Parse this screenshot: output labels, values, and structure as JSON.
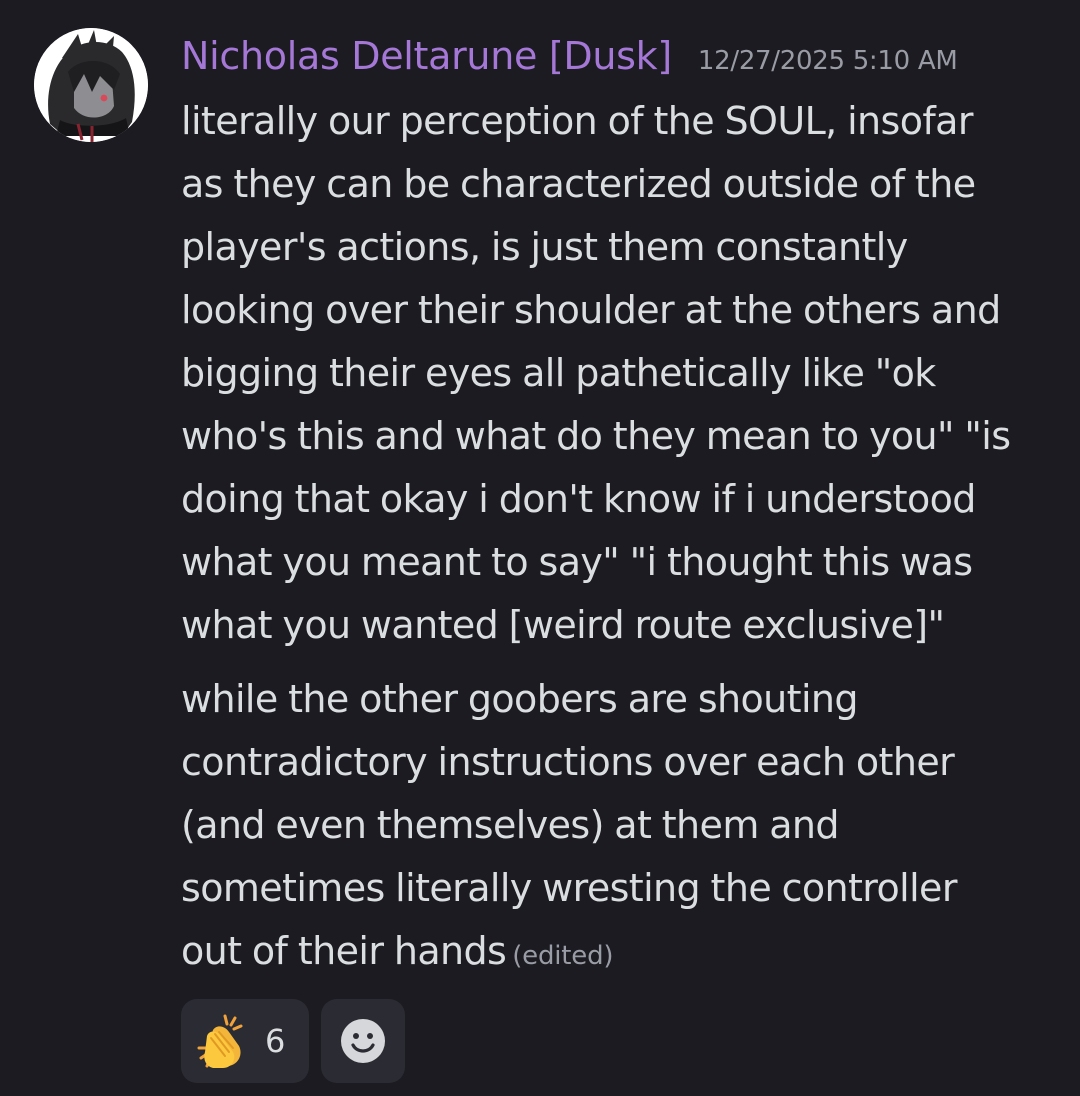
{
  "message": {
    "author": "Nicholas Deltarune [Dusk]",
    "timestamp": "12/27/2025 5:10 AM",
    "paragraph1": [
      "literally our perception of the SOUL, insofar",
      "as they can be characterized outside of the",
      "player's actions, is just them constantly",
      "looking over their shoulder at the others and",
      "bigging their eyes all pathetically like \"ok",
      "who's this and what do they mean to you\" \"is",
      "doing that okay i don't know if i understood",
      "what you meant to say\" \"i thought this was",
      "what you wanted [weird route exclusive]\""
    ],
    "paragraph2": [
      "while the other goobers are shouting",
      "contradictory instructions over each other",
      "(and even themselves) at them and",
      "sometimes literally wresting the controller",
      "out of their hands"
    ],
    "edited_label": "(edited)"
  },
  "reactions": [
    {
      "icon": "clapping-hands-icon",
      "count": "6"
    },
    {
      "icon": "add-reaction-smiley-icon"
    }
  ],
  "colors": {
    "background": "#1b1b21",
    "username": "#a577d6",
    "text": "#dbdee1",
    "muted": "#9a9ca5",
    "reaction_bg": "#2b2c33"
  }
}
